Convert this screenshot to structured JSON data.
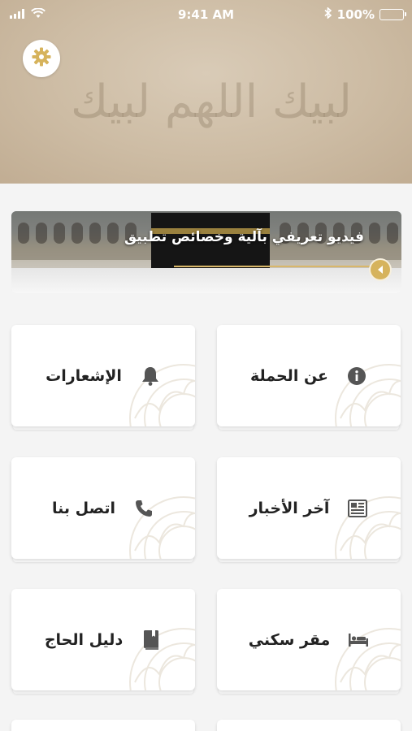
{
  "status_bar": {
    "time": "9:41 AM",
    "battery": "100%"
  },
  "header": {
    "calligraphy": "لبيك اللهم لبيك"
  },
  "banner": {
    "title": "فيديو تعريفي بآلية وخصائص تطبيق"
  },
  "tiles": [
    {
      "label": "عن الحملة",
      "icon": "info-icon"
    },
    {
      "label": "الإشعارات",
      "icon": "bell-icon"
    },
    {
      "label": "آخر الأخبار",
      "icon": "newspaper-icon"
    },
    {
      "label": "اتصل بنا",
      "icon": "phone-icon"
    },
    {
      "label": "مقر سكني",
      "icon": "bed-icon"
    },
    {
      "label": "دليل الحاج",
      "icon": "book-icon"
    }
  ],
  "colors": {
    "accent_gold": "#d6b35c",
    "header_tan": "#cdbca4",
    "icon_gray": "#555555"
  }
}
